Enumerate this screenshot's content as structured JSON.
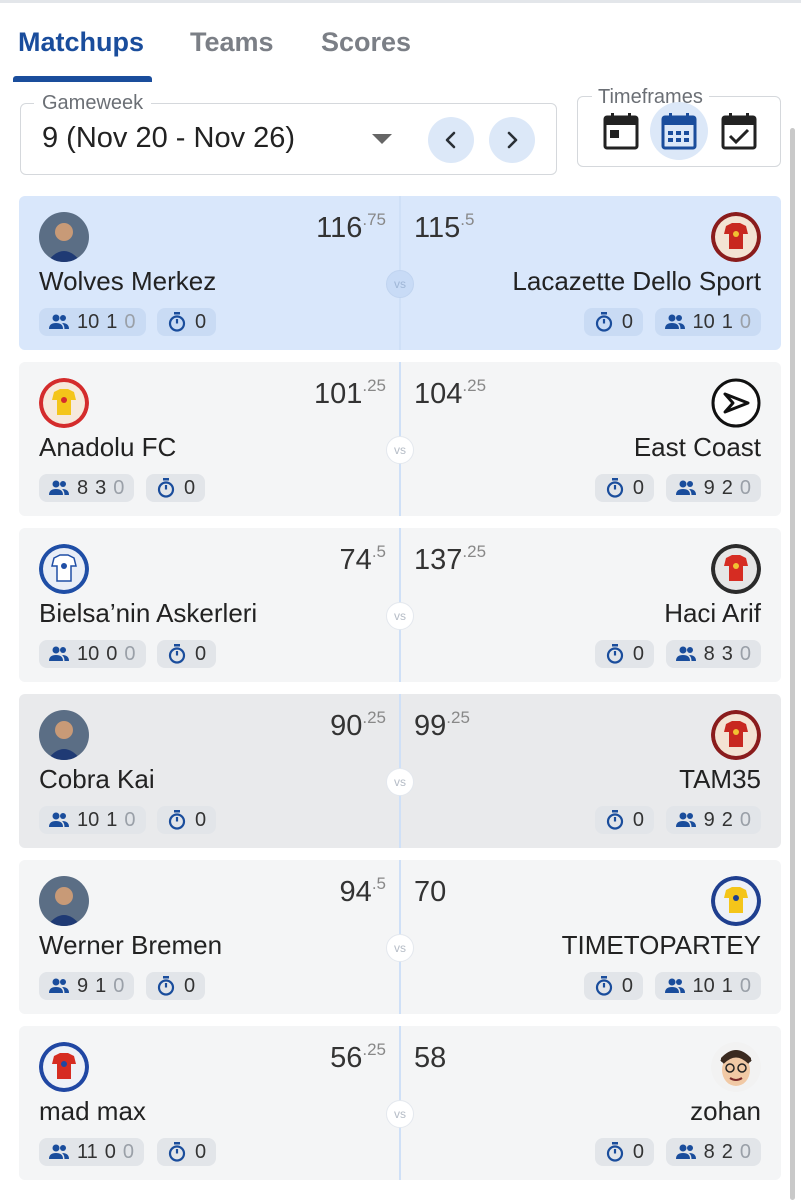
{
  "tabs": [
    {
      "label": "Matchups",
      "active": true
    },
    {
      "label": "Teams",
      "active": false
    },
    {
      "label": "Scores",
      "active": false
    }
  ],
  "gameweek": {
    "label": "Gameweek",
    "value": "9 (Nov 20 - Nov 26)",
    "prev_icon": "chevron-left-icon",
    "next_icon": "chevron-right-icon"
  },
  "timeframes": {
    "label": "Timeframes",
    "icons": [
      "calendar-day-icon",
      "calendar-week-icon",
      "calendar-check-icon"
    ],
    "active_index": 1
  },
  "colors": {
    "accent": "#1a4d9c",
    "highlight": "#d9e7fb",
    "chip": "#e2e5e9"
  },
  "vs_label": "vs",
  "matches": [
    {
      "left": {
        "name": "Wolves Merkez",
        "score_main": "116",
        "score_frac": ".75",
        "avatar": "photo-avatar",
        "players": [
          "10",
          "1",
          "0"
        ],
        "timer": "0"
      },
      "right": {
        "name": "Lacazette Dello Sport",
        "score_main": "115",
        "score_frac": ".5",
        "avatar": "red-shirt-avatar",
        "players": [
          "10",
          "1",
          "0"
        ],
        "timer": "0"
      }
    },
    {
      "left": {
        "name": "Anadolu FC",
        "score_main": "101",
        "score_frac": ".25",
        "avatar": "yellow-red-shirt-avatar",
        "players": [
          "8",
          "3",
          "0"
        ],
        "timer": "0"
      },
      "right": {
        "name": "East Coast",
        "score_main": "104",
        "score_frac": ".25",
        "avatar": "arrow-logo-avatar",
        "players": [
          "9",
          "2",
          "0"
        ],
        "timer": "0"
      }
    },
    {
      "left": {
        "name": "Bielsa’nin Askerleri",
        "score_main": "74",
        "score_frac": ".5",
        "avatar": "white-blue-shirt-avatar",
        "players": [
          "10",
          "0",
          "0"
        ],
        "timer": "0"
      },
      "right": {
        "name": "Haci Arif",
        "score_main": "137",
        "score_frac": ".25",
        "avatar": "red-shirt-dark-avatar",
        "players": [
          "8",
          "3",
          "0"
        ],
        "timer": "0"
      }
    },
    {
      "left": {
        "name": "Cobra Kai",
        "score_main": "90",
        "score_frac": ".25",
        "avatar": "photo-avatar",
        "players": [
          "10",
          "1",
          "0"
        ],
        "timer": "0"
      },
      "right": {
        "name": "TAM35",
        "score_main": "99",
        "score_frac": ".25",
        "avatar": "red-shirt-avatar",
        "players": [
          "9",
          "2",
          "0"
        ],
        "timer": "0"
      }
    },
    {
      "left": {
        "name": "Werner Bremen",
        "score_main": "94",
        "score_frac": ".5",
        "avatar": "photo-avatar",
        "players": [
          "9",
          "1",
          "0"
        ],
        "timer": "0"
      },
      "right": {
        "name": "TIMETOPARTEY",
        "score_main": "70",
        "score_frac": "",
        "avatar": "yellow-blue-shirt-avatar",
        "players": [
          "10",
          "1",
          "0"
        ],
        "timer": "0"
      }
    },
    {
      "left": {
        "name": "mad max",
        "score_main": "56",
        "score_frac": ".25",
        "avatar": "red-blue-shirt-avatar",
        "players": [
          "11",
          "0",
          "0"
        ],
        "timer": "0"
      },
      "right": {
        "name": "zohan",
        "score_main": "58",
        "score_frac": "",
        "avatar": "cartoon-face-avatar",
        "players": [
          "8",
          "2",
          "0"
        ],
        "timer": "0"
      }
    }
  ]
}
